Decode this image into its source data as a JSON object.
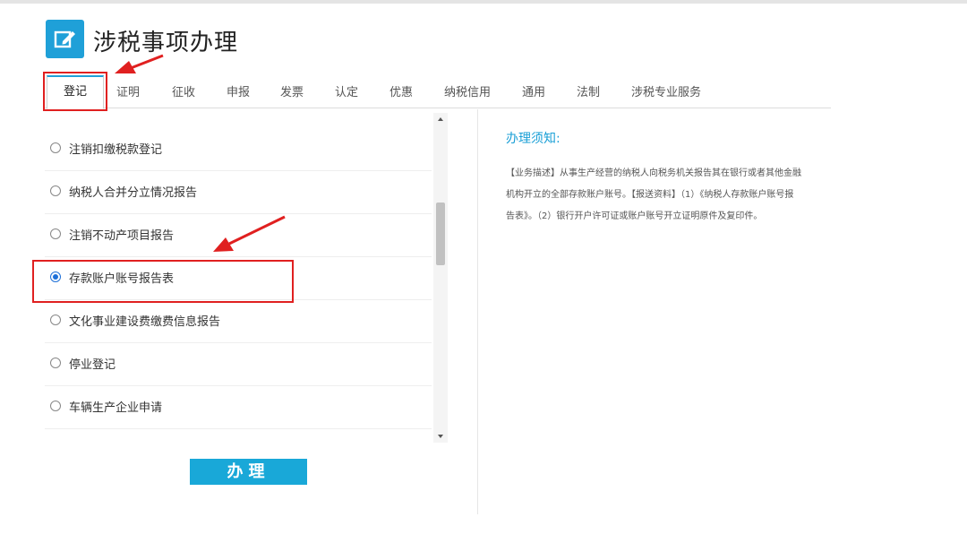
{
  "header": {
    "title": "涉税事项办理",
    "icon": "edit-icon",
    "icon_color": "#1fa0d8"
  },
  "tabs": [
    {
      "label": "登记",
      "active": true
    },
    {
      "label": "证明"
    },
    {
      "label": "征收"
    },
    {
      "label": "申报"
    },
    {
      "label": "发票"
    },
    {
      "label": "认定"
    },
    {
      "label": "优惠"
    },
    {
      "label": "纳税信用"
    },
    {
      "label": "通用"
    },
    {
      "label": "法制"
    },
    {
      "label": "涉税专业服务"
    }
  ],
  "items": [
    {
      "label": "注销扣缴税款登记",
      "checked": false
    },
    {
      "label": "纳税人合并分立情况报告",
      "checked": false
    },
    {
      "label": "注销不动产项目报告",
      "checked": false
    },
    {
      "label": "存款账户账号报告表",
      "checked": true
    },
    {
      "label": "文化事业建设费缴费信息报告",
      "checked": false
    },
    {
      "label": "停业登记",
      "checked": false
    },
    {
      "label": "车辆生产企业申请",
      "checked": false
    }
  ],
  "submit_label": "办理",
  "notice": {
    "title": "办理须知:",
    "text": "【业务描述】从事生产经营的纳税人向税务机关报告其在银行或者其他金融机构开立的全部存款账户账号。【报送资料】（1）《纳税人存款账户账号报告表》。（2）银行开户许可证或账户账号开立证明原件及复印件。"
  },
  "colors": {
    "accent": "#1fa0d8",
    "button": "#19a8d8",
    "annotation": "#e02020",
    "radio_checked": "#1e70d8"
  }
}
